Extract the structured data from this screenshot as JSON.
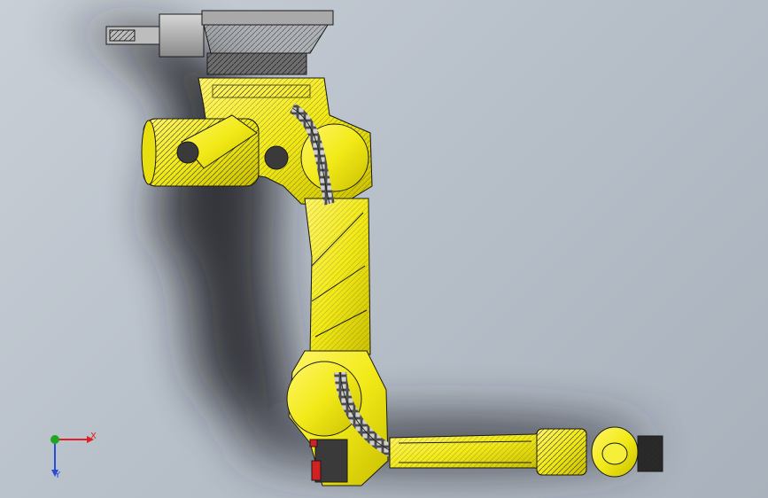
{
  "viewport": {
    "background_color": "#b9c1cb",
    "model_color": "#f2ec1c",
    "edge_color": "#1a1a1a"
  },
  "triad": {
    "x_label": "X",
    "y_label": "Y",
    "x_color": "#e02020",
    "y_color": "#2a4bd8",
    "z_color": "#1fa81f"
  }
}
